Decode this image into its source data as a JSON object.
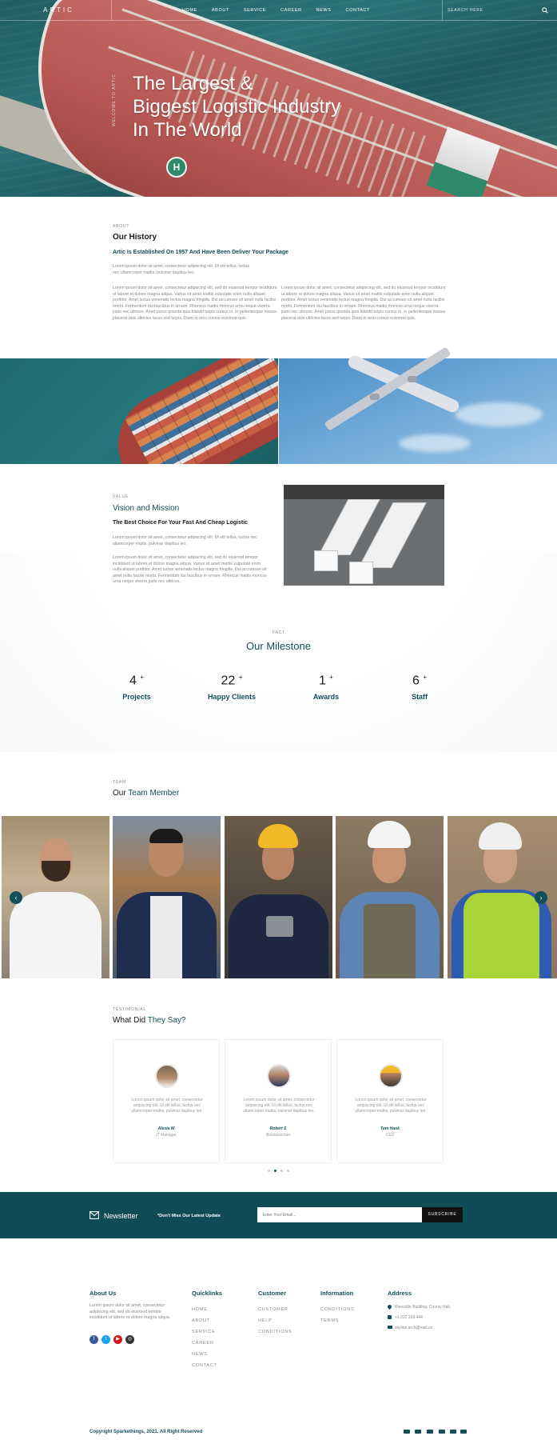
{
  "nav": {
    "logo": "ARTIC",
    "links": [
      "HOME",
      "ABOUT",
      "SERVICE",
      "CAREER",
      "NEWS",
      "CONTACT"
    ],
    "search_placeholder": "SEARCH HERE"
  },
  "hero": {
    "side_text": "WELCOME TO ARTIC",
    "title_line1": "The Largest &",
    "title_line2": "Biggest Logistic Industry",
    "title_line3": "In The World",
    "helipad_letter": "H"
  },
  "about": {
    "eyebrow": "ABOUT",
    "title": "Our History",
    "subtitle": "Artic Is Established On 1957 And Have Been Deliver Your Package",
    "intro": "Lorem ipsum dolor sit amet, consectetur adipiscing elit. Ut elit tellus, luctus nec ullamcorper mattis, pulvinar dapibus leo.",
    "col1": "Lorem ipsum dolor sit amet, consectetur adipiscing elit, sed do eiusmod tempor incididunt ut labore et dolore magna aliqua. Varius sit amet mattis vulputate enim nulla aliquet porttitor. Amet luctus venenatis lectus magna fringilla. Dui accumsan sit amet nulla facilisi morbi. Fermentum dui faucibus in ornare. Rhoncus mattis rhoncus urna neque viverra justo nec ultrices. Amet purus gravida quis blandit turpis cursus in. In pellentesque massa placerat duis ultricies lacus sed turpis. Diam in arcu cursus euismod quis.",
    "col2": "Lorem ipsum dolor sit amet, consectetur adipiscing elit, sed do eiusmod tempor incididunt ut labore et dolore magna aliqua. Varius sit amet mattis vulputate enim nulla aliquet porttitor. Amet luctus venenatis lectus magna fringilla. Dui accumsan sit amet nulla facilisi morbi. Fermentum dui faucibus in ornare. Rhoncus mattis rhoncus urna neque viverra justo nec ultrices. Amet purus gravida quis blandit turpis cursus in. In pellentesque massa placerat duis ultricies lacus sed turpis. Diam in arcu cursus euismod quis."
  },
  "value": {
    "eyebrow": "VALUE",
    "title": "Vision and Mission",
    "subtitle": "The Best Choice For Your Fast And Cheap Logistic",
    "intro": "Lorem ipsum dolor sit amet, consectetur adipiscing elit. Ut elit tellus, luctus nec ullamcorper mattis, pulvinar dapibus leo.",
    "body": "Lorem ipsum dolor sit amet, consectetur adipiscing elit, sed do eiusmod tempor incididunt ut labore et dolore magna aliqua. Varius sit amet mattis vulputate enim nulla aliquet porttitor. Amet luctus venenatis lectus magna fringilla. Dui accumsan sit amet nulla facilisi morbi. Fermentum dui faucibus in ornare. Rhoncus mattis rhoncus urna neque viverra justo nec ultrices."
  },
  "milestone": {
    "eyebrow": "FACT",
    "title": "Our Milestone",
    "stats": [
      {
        "num": "4",
        "plus": "+",
        "label": "Projects"
      },
      {
        "num": "22",
        "plus": "+",
        "label": "Happy Clients"
      },
      {
        "num": "1",
        "plus": "+",
        "label": "Awards"
      },
      {
        "num": "6",
        "plus": "+",
        "label": "Staff"
      }
    ]
  },
  "team": {
    "eyebrow": "TEAM",
    "title_plain": "Our",
    "title_accent": "Team Member",
    "prev": "‹",
    "next": "›"
  },
  "testimonial": {
    "eyebrow": "TESTIMONIAL",
    "title_plain": "What Did",
    "title_accent": "They Say?",
    "items": [
      {
        "quote": "Lorem ipsum dolor sit amet, consectetur adipiscing elit. Ut elit tellus, luctus nec ullamcorper mattis, pulvinar dapibus leo.",
        "name": "Alexia W",
        "role": "IT Manager"
      },
      {
        "quote": "Lorem ipsum dolor sit amet, consectetur adipiscing elit. Ut elit tellus, luctus nec ullamcorper mattis, pulvinar dapibus leo.",
        "name": "Robert S",
        "role": "Businessman"
      },
      {
        "quote": "Lorem ipsum dolor sit amet, consectetur adipiscing elit. Ut elit tellus, luctus nec ullamcorper mattis, pulvinar dapibus leo.",
        "name": "Tom Hank",
        "role": "CEO"
      }
    ]
  },
  "newsletter": {
    "title": "Newsletter",
    "tagline": "*Don't Miss Our Latest Update",
    "placeholder": "Enter Your Email...",
    "button": "SUBSCRIBE"
  },
  "footer": {
    "about_title": "About Us",
    "about_text": "Lorem ipsum dolor sit amet, consectetur adipiscing elit, sed do eiusmod tempor incididunt ut labore et dolore magna aliqua.",
    "quicklinks_title": "Quicklinks",
    "quicklinks": [
      "HOME",
      "ABOUT",
      "SERVICE",
      "CAREER",
      "NEWS",
      "CONTACT"
    ],
    "customer_title": "Customer",
    "customer_links": [
      "CUSTOMER",
      "HELP",
      "CONDITIONS"
    ],
    "information_title": "Information",
    "information_links": [
      "CONDITIONS",
      "TERMS"
    ],
    "address_title": "Address",
    "address": "Riverside Building, County Hall,",
    "phone": "+1 222 333 444",
    "email": "skyline.arch@mail.co",
    "copyright": "Copyright Sparkethings, 2021. All Right Reserved"
  },
  "colors": {
    "accent": "#124f5a",
    "newsletter_bg": "#0f4c56"
  }
}
